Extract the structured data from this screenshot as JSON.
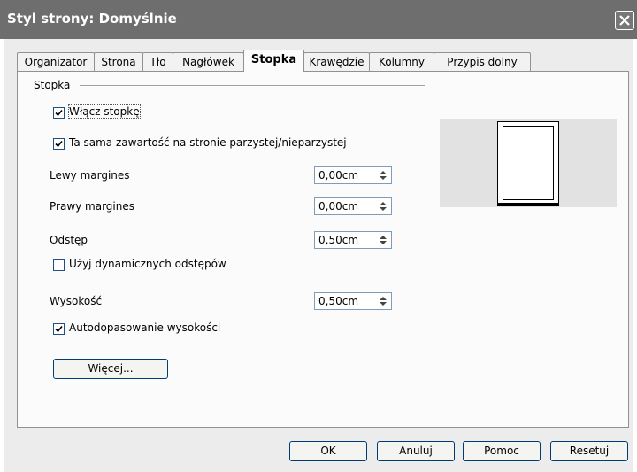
{
  "window": {
    "title": "Styl strony: Domyślnie"
  },
  "tabs": [
    "Organizator",
    "Strona",
    "Tło",
    "Nagłówek",
    "Stopka",
    "Krawędzie",
    "Kolumny",
    "Przypis dolny"
  ],
  "active_tab": "Stopka",
  "footer_section": {
    "group_label": "Stopka",
    "enable_footer": {
      "label": "Włącz stopkę",
      "checked": true
    },
    "same_content": {
      "label": "Ta sama zawartość na stronie parzystej/nieparzystej",
      "checked": true
    },
    "left_margin": {
      "label": "Lewy margines",
      "value": "0,00cm"
    },
    "right_margin": {
      "label": "Prawy margines",
      "value": "0,00cm"
    },
    "spacing": {
      "label": "Odstęp",
      "value": "0,50cm"
    },
    "dynamic_spacing": {
      "label": "Użyj dynamicznych odstępów",
      "checked": false
    },
    "height": {
      "label": "Wysokość",
      "value": "0,50cm"
    },
    "autofit_height": {
      "label": "Autodopasowanie wysokości",
      "checked": true
    },
    "more_button": "Więcej..."
  },
  "buttons": {
    "ok": "OK",
    "cancel": "Anuluj",
    "help": "Pomoc",
    "reset": "Resetuj"
  }
}
